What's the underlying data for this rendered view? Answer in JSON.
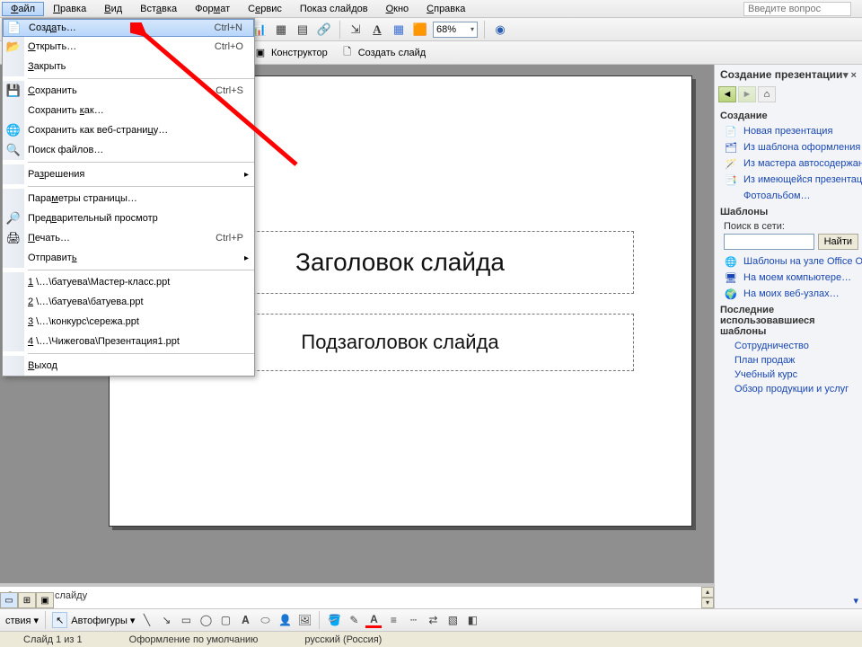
{
  "menubar": {
    "items": [
      {
        "label": "Файл",
        "hot": "Ф",
        "open": true
      },
      {
        "label": "Правка",
        "hot": "П"
      },
      {
        "label": "Вид",
        "hot": "В"
      },
      {
        "label": "Вставка",
        "hot": "а"
      },
      {
        "label": "Формат",
        "hot": "м"
      },
      {
        "label": "Сервис",
        "hot": "е"
      },
      {
        "label": "Показ слайдов"
      },
      {
        "label": "Окно",
        "hot": "О"
      },
      {
        "label": "Справка",
        "hot": "С"
      }
    ],
    "helpbox_placeholder": "Введите вопрос"
  },
  "toolbar1": {
    "zoom": "68%"
  },
  "toolbar2": {
    "designer_label": "Конструктор",
    "newslide_label": "Создать слайд"
  },
  "file_menu": {
    "items": [
      {
        "icon": "new-file-icon",
        "label": "Создать…",
        "hot": "а",
        "shortcut": "Ctrl+N",
        "selected": true
      },
      {
        "icon": "open-icon",
        "label": "Открыть…",
        "hot": "О",
        "shortcut": "Ctrl+O"
      },
      {
        "icon": "",
        "label": "Закрыть",
        "hot": "З"
      },
      {
        "sep": true
      },
      {
        "icon": "save-icon",
        "label": "Сохранить",
        "hot": "С",
        "shortcut": "Ctrl+S"
      },
      {
        "icon": "",
        "label": "Сохранить как…",
        "hot": "к"
      },
      {
        "icon": "save-web-icon",
        "label": "Сохранить как веб-страницу…",
        "hot": "ц"
      },
      {
        "icon": "search-file-icon",
        "label": "Поиск файлов…"
      },
      {
        "sep": true
      },
      {
        "icon": "",
        "label": "Разрешения",
        "hot": "з",
        "submenu": true
      },
      {
        "sep": true
      },
      {
        "icon": "",
        "label": "Параметры страницы…",
        "hot": "м"
      },
      {
        "icon": "preview-icon",
        "label": "Предварительный просмотр",
        "hot": "в"
      },
      {
        "icon": "print-icon",
        "label": "Печать…",
        "hot": "П",
        "shortcut": "Ctrl+P"
      },
      {
        "icon": "",
        "label": "Отправить",
        "hot": "ь",
        "submenu": true
      },
      {
        "sep": true
      },
      {
        "icon": "",
        "label": "1 \\…\\батуева\\Мастер-класс.ppt",
        "hot": "1"
      },
      {
        "icon": "",
        "label": "2 \\…\\батуева\\батуева.ppt",
        "hot": "2"
      },
      {
        "icon": "",
        "label": "3 \\…\\конкурс\\сережа.ppt",
        "hot": "3"
      },
      {
        "icon": "",
        "label": "4 \\…\\Чижегова\\Презентация1.ppt",
        "hot": "4"
      },
      {
        "sep": true
      },
      {
        "icon": "",
        "label": "Выход",
        "hot": "В"
      }
    ]
  },
  "slide": {
    "title_placeholder": "Заголовок слайда",
    "subtitle_placeholder": "Подзаголовок слайда"
  },
  "notes": {
    "placeholder": "Заметки к слайду"
  },
  "taskpane": {
    "title": "Создание презентации",
    "section_create": "Создание",
    "create_links": [
      {
        "icon": "blank-icon",
        "label": "Новая презентация"
      },
      {
        "icon": "template-icon",
        "label": "Из шаблона оформления"
      },
      {
        "icon": "wizard-icon",
        "label": "Из мастера автосодержания…"
      },
      {
        "icon": "existing-icon",
        "label": "Из имеющейся презентации…"
      },
      {
        "icon": "",
        "label": "Фотоальбом…"
      }
    ],
    "section_templates": "Шаблоны",
    "search_label": "Поиск в сети:",
    "search_button": "Найти",
    "template_links": [
      {
        "icon": "office-online-icon",
        "label": "Шаблоны на узле Office Online"
      },
      {
        "icon": "computer-icon",
        "label": "На моем компьютере…"
      },
      {
        "icon": "web-icon",
        "label": "На моих веб-узлах…"
      }
    ],
    "section_recent": "Последние использовавшиеся шаблоны",
    "recent": [
      "Сотрудничество",
      "План продаж",
      "Учебный курс",
      "Обзор продукции и услуг"
    ]
  },
  "drawbar": {
    "actions_label": "ствия ▾",
    "autoshapes_label": "Автофигуры ▾"
  },
  "statusbar": {
    "slide": "Слайд 1 из 1",
    "design": "Оформление по умолчанию",
    "lang": "русский (Россия)"
  }
}
